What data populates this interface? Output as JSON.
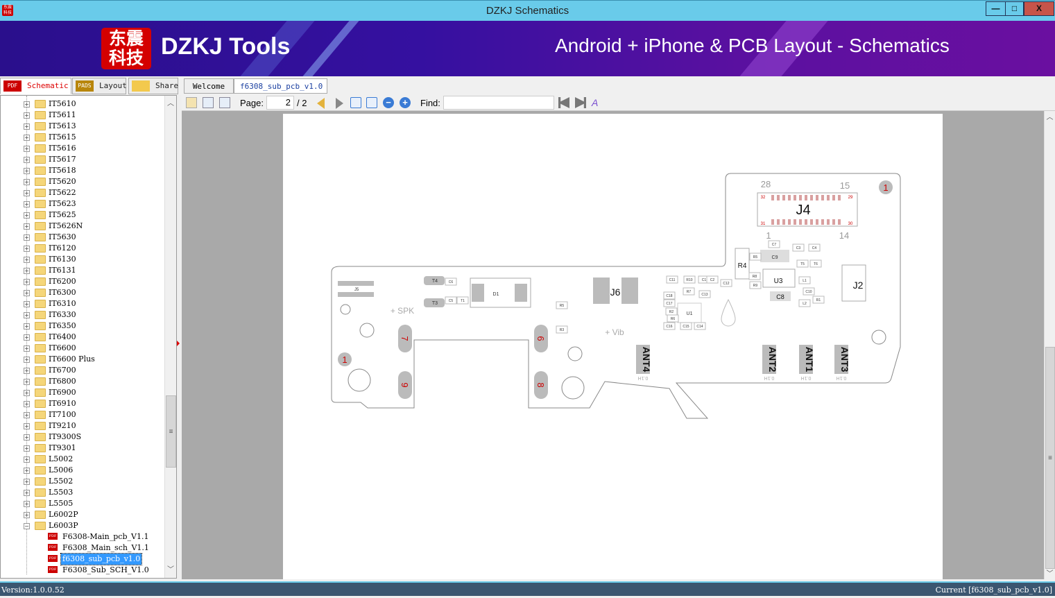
{
  "window": {
    "title": "DZKJ Schematics",
    "minimize": "—",
    "maximize": "□",
    "close": "X"
  },
  "banner": {
    "logo": "东震科技",
    "brand": "DZKJ Tools",
    "tagline": "Android + iPhone & PCB Layout - Schematics"
  },
  "left_tabs": [
    {
      "label": "Schematic",
      "icon": "PDF",
      "active": true
    },
    {
      "label": "Layout",
      "icon": "PADS",
      "active": false
    },
    {
      "label": "Share",
      "icon": "cloud-folder",
      "active": false
    }
  ],
  "doc_tabs": [
    {
      "label": "Welcome",
      "active": false
    },
    {
      "label": "f6308_sub_pcb_v1.0",
      "active": true,
      "close": "×"
    }
  ],
  "tree": {
    "folders": [
      "IT5610",
      "IT5611",
      "IT5613",
      "IT5615",
      "IT5616",
      "IT5617",
      "IT5618",
      "IT5620",
      "IT5622",
      "IT5623",
      "IT5625",
      "IT5626N",
      "IT5630",
      "IT6120",
      "IT6130",
      "IT6131",
      "IT6200",
      "IT6300",
      "IT6310",
      "IT6330",
      "IT6350",
      "IT6400",
      "IT6600",
      "IT6600 Plus",
      "IT6700",
      "IT6800",
      "IT6900",
      "IT6910",
      "IT7100",
      "IT9210",
      "IT9300S",
      "IT9301",
      "L5002",
      "L5006",
      "L5502",
      "L5503",
      "L5505",
      "L6002P"
    ],
    "expanded_folder": "L6003P",
    "files": [
      "F6308-Main_pcb_V1.1",
      "F6308_Main_sch_V1.1",
      "f6308_sub_pcb_v1.0",
      "F6308_Sub_SCH_V1.0"
    ],
    "selected": "f6308_sub_pcb_v1.0"
  },
  "toolbar": {
    "page_label": "Page:",
    "page_value": "2",
    "page_total": "/ 2",
    "find_label": "Find:",
    "find_value": ""
  },
  "pcb": {
    "connectors": {
      "J4": "J4",
      "J6": "J6",
      "J2": "J2",
      "J5": "J5"
    },
    "j4_pins": {
      "top_left": "28",
      "top_right": "15",
      "bottom_left": "1",
      "bottom_right": "14",
      "c32": "32",
      "c29": "29",
      "c31": "31",
      "c30": "30"
    },
    "antennas": [
      "ANT4",
      "ANT2",
      "ANT1",
      "ANT3"
    ],
    "ant_sub": "0.1H",
    "labels": {
      "spk": "+ SPK",
      "vib": "+ Vib",
      "d1": "D1",
      "r4": "R4",
      "u3": "U3",
      "u1": "U1",
      "c8": "C8",
      "c9": "C9",
      "t4": "T4",
      "t3": "T3"
    },
    "pads": {
      "p7": "7",
      "p6": "6",
      "p9": "9",
      "p8": "8",
      "fid1": "1"
    },
    "small_parts": [
      "C7",
      "C3",
      "C4",
      "R5",
      "T5",
      "T6",
      "R8",
      "L1",
      "C10",
      "L2",
      "R1",
      "C11",
      "R10",
      "C1",
      "C2",
      "C12",
      "R9",
      "R7",
      "C13",
      "C18",
      "C17",
      "R2",
      "R6",
      "C16",
      "C15",
      "C14",
      "C6",
      "C5",
      "T1",
      "R5",
      "R3"
    ]
  },
  "status": {
    "version": "Version:1.0.0.52",
    "current": "Current [f6308_sub_pcb_v1.0]"
  },
  "colors": {
    "titlebar": "#69cbea",
    "banner": "#3510a0",
    "selection": "#3399ff",
    "pad": "#bdbdbd",
    "pad_text": "#d00000"
  }
}
